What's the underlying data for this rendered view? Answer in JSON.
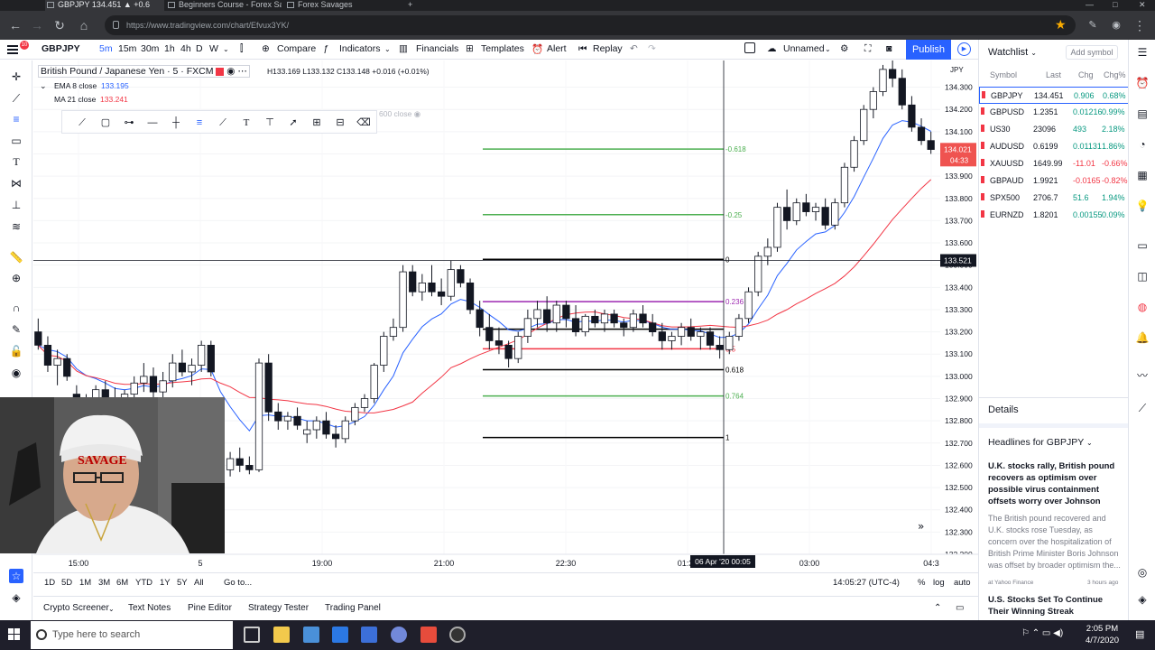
{
  "browser": {
    "tabs": [
      {
        "title": "GBPJPY 134.451 ▲ +0.6"
      },
      {
        "title": "Beginners Course - Forex Sa"
      },
      {
        "title": "Forex Savages"
      }
    ],
    "url": "https://www.tradingview.com/chart/Efvux3YK/"
  },
  "toolbar": {
    "symbol": "GBPJPY",
    "intervals": [
      "5m",
      "15m",
      "30m",
      "1h",
      "4h",
      "D",
      "W"
    ],
    "compare": "Compare",
    "indicators": "Indicators",
    "financials": "Financials",
    "templates": "Templates",
    "alert": "Alert",
    "replay": "Replay",
    "layout": "Unnamed",
    "publish": "Publish",
    "notif_count": "10"
  },
  "legend": {
    "symbol": "British Pound / Japanese Yen · 5 · FXCM",
    "ohlc": "H133.169  L133.132  C133.148  +0.016 (+0.01%)",
    "ema_label": "EMA 8 close",
    "ema_value": "133.195",
    "ma_label": "MA 21 close",
    "ma_value": "133.241",
    "hidden_label": "600 close"
  },
  "chart_data": {
    "type": "candlestick",
    "symbol": "GBPJPY",
    "currency": "JPY",
    "y_ticks": [
      "134.300",
      "134.200",
      "134.100",
      "134.000",
      "133.900",
      "133.800",
      "133.700",
      "133.600",
      "133.500",
      "133.400",
      "133.300",
      "133.200",
      "133.100",
      "133.000",
      "132.900",
      "132.800",
      "132.700",
      "132.600",
      "132.500",
      "132.400",
      "132.300",
      "132.200"
    ],
    "ylim": [
      132.2,
      134.42
    ],
    "x_ticks": [
      "15:00",
      "5",
      "19:00",
      "21:00",
      "22:30",
      "01:30",
      "03:00",
      "04:3"
    ],
    "cursor_time": "06 Apr '20  00:05",
    "cursor_price": "133.521",
    "last_price": "134.021",
    "countdown": "04:33",
    "fib_levels": [
      {
        "label": "-0.618",
        "price": 134.022,
        "color": "#4caf50"
      },
      {
        "label": "-0.25",
        "price": 133.727,
        "color": "#4caf50"
      },
      {
        "label": "0",
        "price": 133.526,
        "color": "#000000"
      },
      {
        "label": "0.236",
        "price": 133.336,
        "color": "#9c27b0"
      },
      {
        "label": "",
        "price": 133.212,
        "color": "#000000"
      },
      {
        "label": "0.5",
        "price": 133.124,
        "color": "#f23645"
      },
      {
        "label": "0.618",
        "price": 133.03,
        "color": "#000000"
      },
      {
        "label": "0.764",
        "price": 132.912,
        "color": "#4caf50"
      },
      {
        "label": "1",
        "price": 132.725,
        "color": "#000000"
      }
    ],
    "candles": [
      [
        133.2,
        133.26,
        133.12,
        133.14
      ],
      [
        133.14,
        133.18,
        133.02,
        133.05
      ],
      [
        133.05,
        133.12,
        132.96,
        133.08
      ],
      [
        133.08,
        133.1,
        132.98,
        133.0
      ],
      [
        132.92,
        132.96,
        132.8,
        132.85
      ],
      [
        132.85,
        132.92,
        132.8,
        132.9
      ],
      [
        132.9,
        132.96,
        132.86,
        132.94
      ],
      [
        132.94,
        132.98,
        132.88,
        132.9
      ],
      [
        132.9,
        132.95,
        132.82,
        132.86
      ],
      [
        132.86,
        132.94,
        132.83,
        132.92
      ],
      [
        132.92,
        133.0,
        132.88,
        132.97
      ],
      [
        132.97,
        133.06,
        132.93,
        133.0
      ],
      [
        133.0,
        133.04,
        132.9,
        132.93
      ],
      [
        132.93,
        133.02,
        132.9,
        132.98
      ],
      [
        132.98,
        133.1,
        132.95,
        133.06
      ],
      [
        133.06,
        133.12,
        133.0,
        133.02
      ],
      [
        133.02,
        133.08,
        132.96,
        133.05
      ],
      [
        133.05,
        133.16,
        133.02,
        133.14
      ],
      [
        133.14,
        133.16,
        133.0,
        133.02
      ],
      [
        132.62,
        132.66,
        132.55,
        132.58
      ],
      [
        132.58,
        132.66,
        132.55,
        132.63
      ],
      [
        132.63,
        132.68,
        132.57,
        132.6
      ],
      [
        132.6,
        132.64,
        132.56,
        132.58
      ],
      [
        132.58,
        133.08,
        132.57,
        133.06
      ],
      [
        133.06,
        133.1,
        132.8,
        132.84
      ],
      [
        132.84,
        132.88,
        132.76,
        132.8
      ],
      [
        132.8,
        132.84,
        132.76,
        132.82
      ],
      [
        132.82,
        132.86,
        132.76,
        132.78
      ],
      [
        132.74,
        132.8,
        132.7,
        132.76
      ],
      [
        132.76,
        132.82,
        132.72,
        132.8
      ],
      [
        132.8,
        132.84,
        132.72,
        132.74
      ],
      [
        132.74,
        132.78,
        132.68,
        132.72
      ],
      [
        132.72,
        132.82,
        132.7,
        132.8
      ],
      [
        132.8,
        132.88,
        132.78,
        132.86
      ],
      [
        132.86,
        132.92,
        132.84,
        132.9
      ],
      [
        132.9,
        133.06,
        132.88,
        133.05
      ],
      [
        133.05,
        133.2,
        133.02,
        133.18
      ],
      [
        133.18,
        133.26,
        133.16,
        133.22
      ],
      [
        133.22,
        133.5,
        133.2,
        133.47
      ],
      [
        133.47,
        133.5,
        133.36,
        133.38
      ],
      [
        133.38,
        133.46,
        133.34,
        133.42
      ],
      [
        133.42,
        133.5,
        133.36,
        133.38
      ],
      [
        133.38,
        133.44,
        133.32,
        133.36
      ],
      [
        133.36,
        133.52,
        133.34,
        133.48
      ],
      [
        133.48,
        133.5,
        133.4,
        133.42
      ],
      [
        133.42,
        133.44,
        133.28,
        133.3
      ],
      [
        133.3,
        133.34,
        133.18,
        133.22
      ],
      [
        133.22,
        133.28,
        133.12,
        133.16
      ],
      [
        133.16,
        133.22,
        133.1,
        133.14
      ],
      [
        133.14,
        133.16,
        133.04,
        133.08
      ],
      [
        133.08,
        133.2,
        133.06,
        133.18
      ],
      [
        133.18,
        133.3,
        133.15,
        133.26
      ],
      [
        133.26,
        133.34,
        133.22,
        133.3
      ],
      [
        133.3,
        133.36,
        133.2,
        133.24
      ],
      [
        133.24,
        133.34,
        133.2,
        133.32
      ],
      [
        133.32,
        133.34,
        133.22,
        133.26
      ],
      [
        133.26,
        133.32,
        133.18,
        133.2
      ],
      [
        133.2,
        133.28,
        133.18,
        133.27
      ],
      [
        133.27,
        133.3,
        133.22,
        133.24
      ],
      [
        133.24,
        133.3,
        133.2,
        133.28
      ],
      [
        133.28,
        133.3,
        133.22,
        133.24
      ],
      [
        133.24,
        133.26,
        133.18,
        133.22
      ],
      [
        133.22,
        133.3,
        133.2,
        133.28
      ],
      [
        133.28,
        133.32,
        133.22,
        133.24
      ],
      [
        133.24,
        133.28,
        133.18,
        133.2
      ],
      [
        133.2,
        133.24,
        133.12,
        133.16
      ],
      [
        133.16,
        133.2,
        133.12,
        133.18
      ],
      [
        133.18,
        133.24,
        133.14,
        133.22
      ],
      [
        133.22,
        133.26,
        133.16,
        133.18
      ],
      [
        133.18,
        133.22,
        133.12,
        133.2
      ],
      [
        133.2,
        133.22,
        133.12,
        133.14
      ],
      [
        133.14,
        133.18,
        133.08,
        133.12
      ],
      [
        133.12,
        133.2,
        133.1,
        133.18
      ],
      [
        133.18,
        133.28,
        133.16,
        133.26
      ],
      [
        133.26,
        133.4,
        133.24,
        133.38
      ],
      [
        133.38,
        133.56,
        133.36,
        133.54
      ],
      [
        133.54,
        133.62,
        133.5,
        133.58
      ],
      [
        133.58,
        133.78,
        133.56,
        133.76
      ],
      [
        133.76,
        133.84,
        133.66,
        133.7
      ],
      [
        133.7,
        133.8,
        133.68,
        133.78
      ],
      [
        133.78,
        133.82,
        133.72,
        133.74
      ],
      [
        133.74,
        133.78,
        133.7,
        133.76
      ],
      [
        133.76,
        133.8,
        133.66,
        133.68
      ],
      [
        133.68,
        133.8,
        133.66,
        133.78
      ],
      [
        133.78,
        133.96,
        133.76,
        133.94
      ],
      [
        133.94,
        134.08,
        133.92,
        134.06
      ],
      [
        134.06,
        134.22,
        134.04,
        134.2
      ],
      [
        134.2,
        134.3,
        134.16,
        134.28
      ],
      [
        134.28,
        134.4,
        134.26,
        134.38
      ],
      [
        134.38,
        134.42,
        134.3,
        134.34
      ],
      [
        134.34,
        134.38,
        134.2,
        134.22
      ],
      [
        134.22,
        134.26,
        134.1,
        134.12
      ],
      [
        134.12,
        134.16,
        134.04,
        134.06
      ],
      [
        134.06,
        134.1,
        134.0,
        134.02
      ]
    ]
  },
  "watchlist": {
    "title": "Watchlist",
    "add_symbol": "Add symbol",
    "headers": [
      "Symbol",
      "Last",
      "Chg",
      "Chg%"
    ],
    "rows": [
      {
        "symbol": "GBPJPY",
        "last": "134.451",
        "chg": "0.906",
        "pct": "0.68%",
        "up": true
      },
      {
        "symbol": "GBPUSD",
        "last": "1.2351",
        "chg": "0.01216",
        "pct": "0.99%",
        "up": true
      },
      {
        "symbol": "US30",
        "last": "23096",
        "chg": "493",
        "pct": "2.18%",
        "up": true
      },
      {
        "symbol": "AUDUSD",
        "last": "0.6199",
        "chg": "0.01131",
        "pct": "1.86%",
        "up": true
      },
      {
        "symbol": "XAUUSD",
        "last": "1649.99",
        "chg": "-11.01",
        "pct": "-0.66%",
        "up": false
      },
      {
        "symbol": "GBPAUD",
        "last": "1.9921",
        "chg": "-0.0165",
        "pct": "-0.82%",
        "up": false
      },
      {
        "symbol": "SPX500",
        "last": "2706.7",
        "chg": "51.6",
        "pct": "1.94%",
        "up": true
      },
      {
        "symbol": "EURNZD",
        "last": "1.8201",
        "chg": "0.00155",
        "pct": "0.09%",
        "up": true
      }
    ],
    "details": "Details",
    "headlines": "Headlines for GBPJPY",
    "news": [
      {
        "title": "U.K. stocks rally, British pound recovers as optimism over possible virus containment offsets worry over Johnson",
        "body": "The British pound recovered and U.K. stocks rose Tuesday, as concern over the hospitalization of British Prime Minister Boris Johnson was offset by broader optimism the...",
        "source": "at Yahoo Finance",
        "age": "3 hours ago"
      },
      {
        "title": "U.S. Stocks Set To Continue Their Winning Streak",
        "body": "",
        "source": "",
        "age": ""
      }
    ]
  },
  "bottom": {
    "ranges": [
      "1D",
      "5D",
      "1M",
      "3M",
      "6M",
      "YTD",
      "1Y",
      "5Y",
      "All"
    ],
    "goto": "Go to...",
    "time": "14:05:27 (UTC-4)",
    "pct": "%",
    "log": "log",
    "auto": "auto",
    "panels": [
      "Crypto Screener",
      "Text Notes",
      "Pine Editor",
      "Strategy Tester",
      "Trading Panel"
    ]
  },
  "taskbar": {
    "search": "Type here to search",
    "time": "2:05 PM",
    "date": "4/7/2020"
  },
  "webcam": {
    "cap_text": "SAVAGE"
  },
  "colors": {
    "up": "#26a69a",
    "down": "#ef5350",
    "accent": "#2962ff"
  }
}
